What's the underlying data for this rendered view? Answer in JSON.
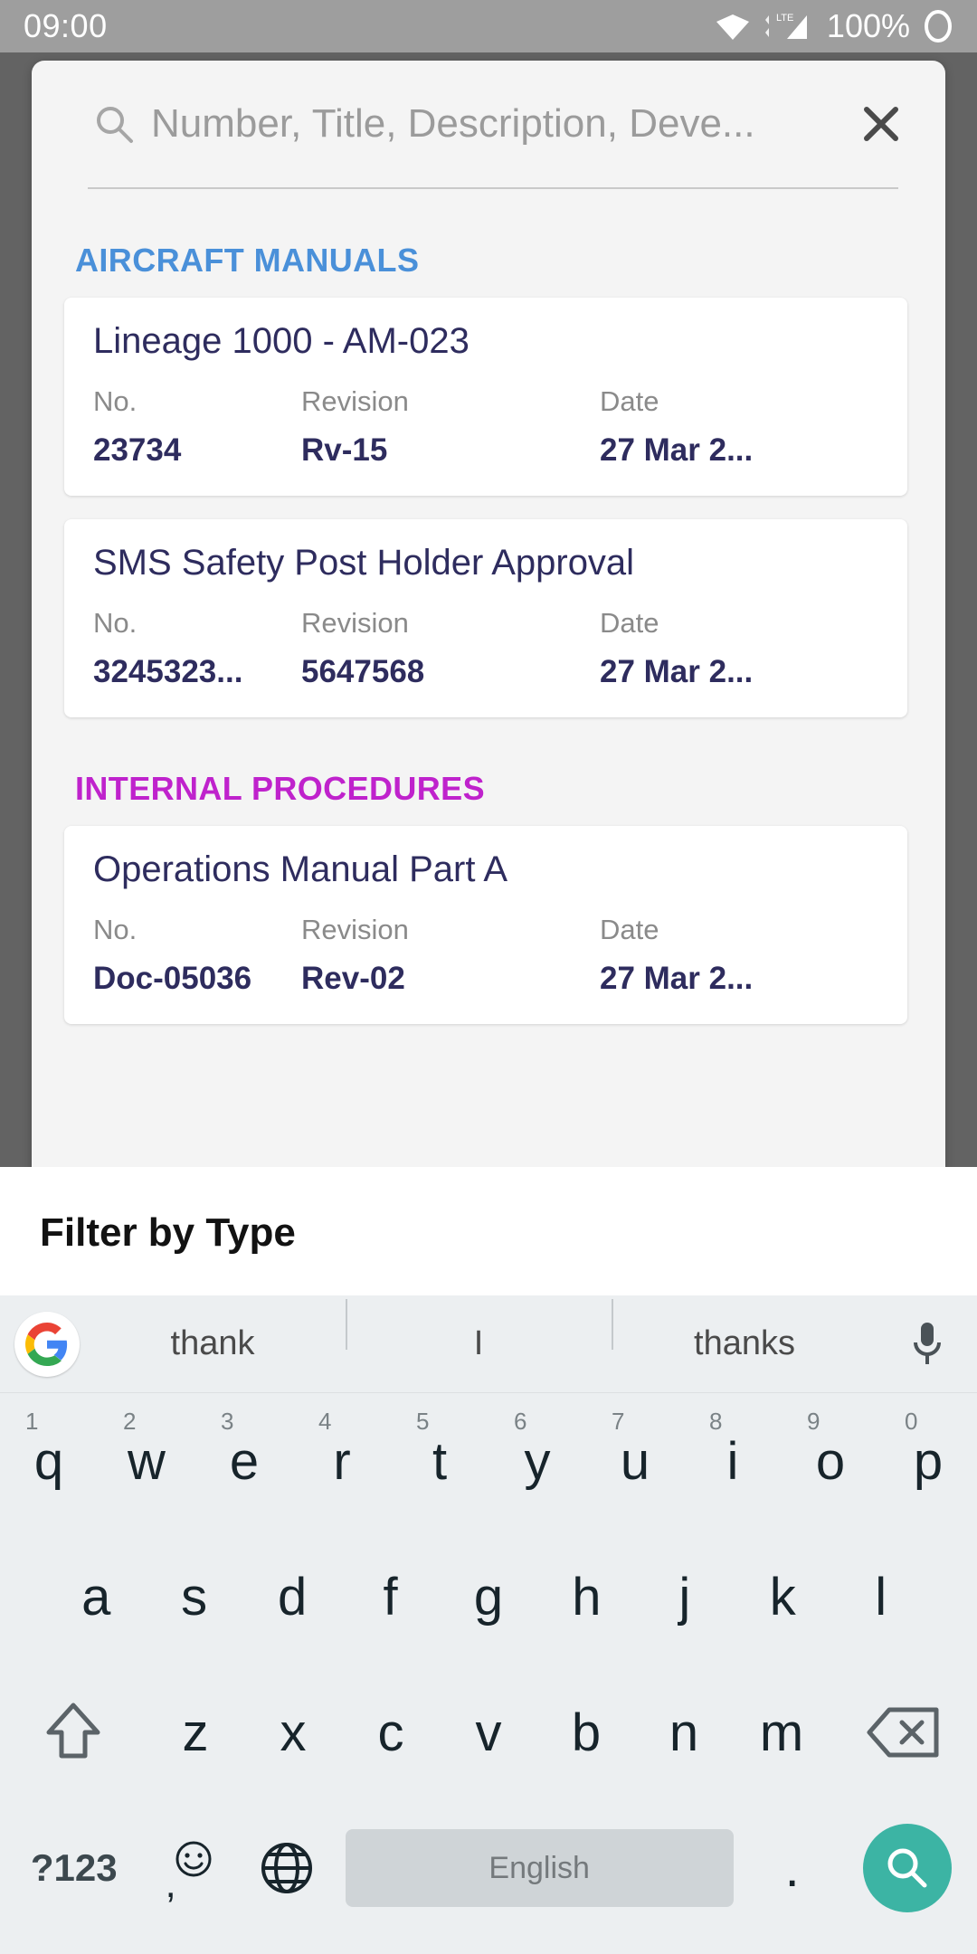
{
  "status_bar": {
    "time": "09:00",
    "battery_text": "100%",
    "network_label": "LTE",
    "icons": [
      "wifi-icon",
      "lte-signal-icon",
      "battery-icon"
    ]
  },
  "dialog": {
    "search": {
      "placeholder": "Number, Title, Description, Deve...",
      "value": "",
      "search_icon": "search-icon",
      "clear_icon": "close-icon"
    },
    "sections": [
      {
        "title": "AIRCRAFT MANUALS",
        "color": "#4a90d9",
        "items": [
          {
            "title": "Lineage 1000 - AM-023",
            "labels": {
              "no": "No.",
              "revision": "Revision",
              "date": "Date"
            },
            "no": "23734",
            "revision": "Rv-15",
            "date": "27 Mar 2..."
          },
          {
            "title": "SMS Safety Post Holder Approval",
            "labels": {
              "no": "No.",
              "revision": "Revision",
              "date": "Date"
            },
            "no": "3245323...",
            "revision": "5647568",
            "date": "27 Mar 2..."
          }
        ]
      },
      {
        "title": "INTERNAL PROCEDURES",
        "color": "#bf22cc",
        "items": [
          {
            "title": "Operations Manual Part A",
            "labels": {
              "no": "No.",
              "revision": "Revision",
              "date": "Date"
            },
            "no": "Doc-05036",
            "revision": "Rev-02",
            "date": "27 Mar 2..."
          }
        ]
      }
    ]
  },
  "bottom_sheet": {
    "title": "Filter by Type"
  },
  "keyboard": {
    "suggestions": [
      "thank",
      "I",
      "thanks"
    ],
    "logo_icon": "google-g-icon",
    "mic_icon": "microphone-icon",
    "row1": [
      {
        "key": "q",
        "num": "1"
      },
      {
        "key": "w",
        "num": "2"
      },
      {
        "key": "e",
        "num": "3"
      },
      {
        "key": "r",
        "num": "4"
      },
      {
        "key": "t",
        "num": "5"
      },
      {
        "key": "y",
        "num": "6"
      },
      {
        "key": "u",
        "num": "7"
      },
      {
        "key": "i",
        "num": "8"
      },
      {
        "key": "o",
        "num": "9"
      },
      {
        "key": "p",
        "num": "0"
      }
    ],
    "row2": [
      "a",
      "s",
      "d",
      "f",
      "g",
      "h",
      "j",
      "k",
      "l"
    ],
    "row3": [
      "z",
      "x",
      "c",
      "v",
      "b",
      "n",
      "m"
    ],
    "shift_icon": "shift-icon",
    "backspace_icon": "backspace-icon",
    "symbols_label": "?123",
    "emoji_icon": "emoji-icon",
    "comma_label": ",",
    "globe_icon": "globe-icon",
    "space_label": "English",
    "period_label": ".",
    "enter_icon": "search-icon",
    "enter_color": "#3cb4a4"
  }
}
